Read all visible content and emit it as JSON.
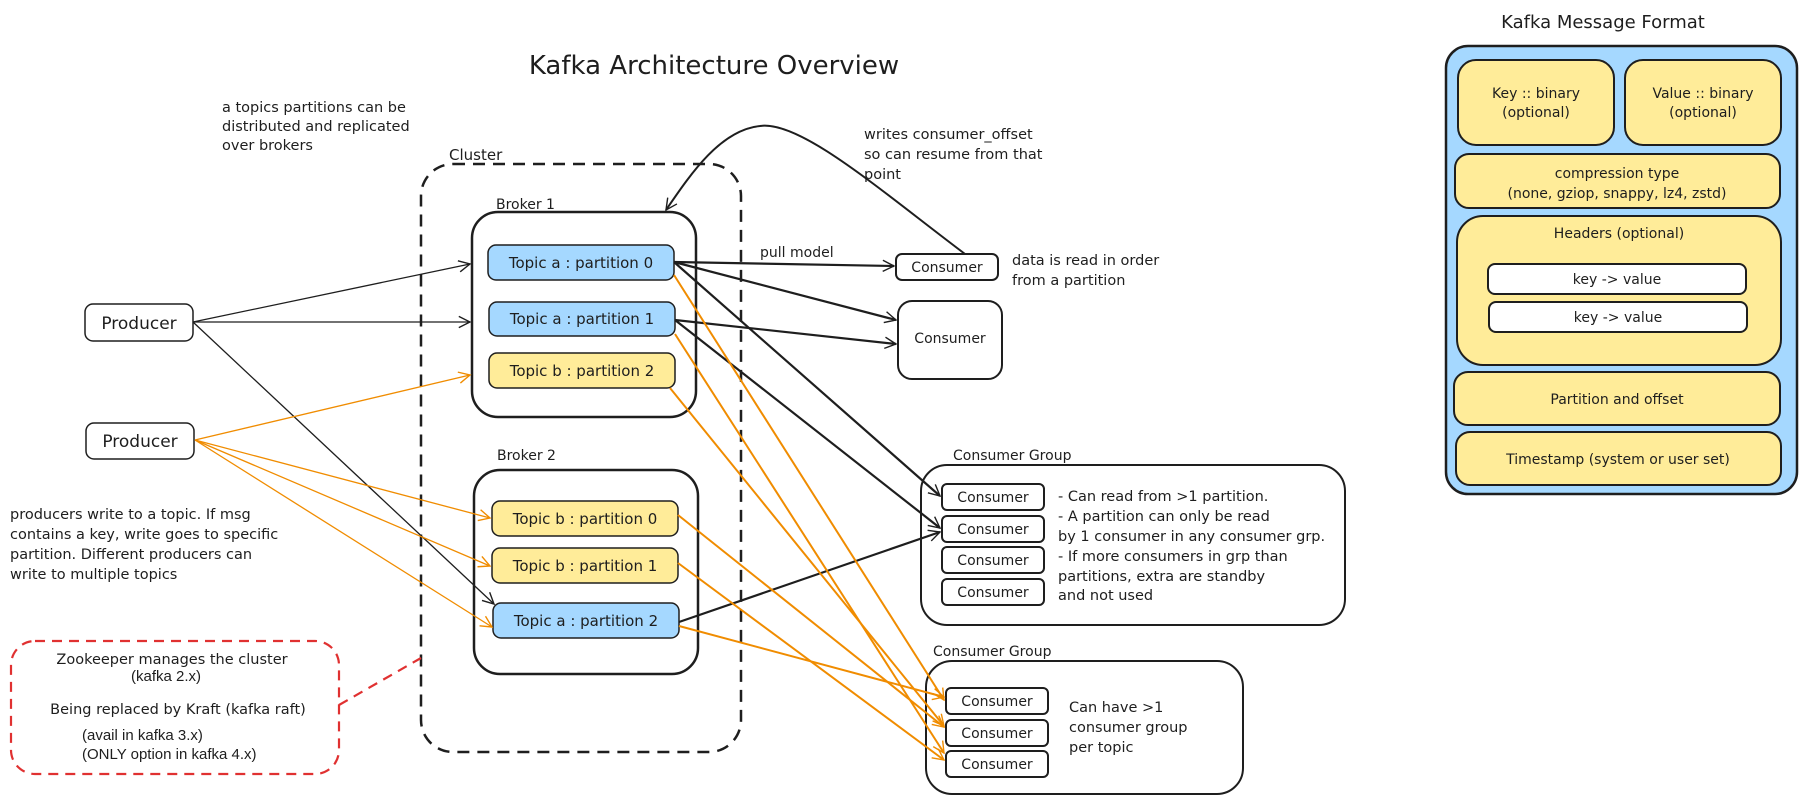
{
  "title": "Kafka Architecture Overview",
  "notes": {
    "partitions_distributed": [
      "a topics partitions can be",
      "distributed and replicated",
      "over brokers"
    ],
    "consumer_offset": [
      "writes consumer_offset",
      "so can resume from that",
      "point"
    ],
    "read_in_order": [
      "data is read in order",
      "from a partition"
    ],
    "producers_write": [
      "producers write to a topic. If msg",
      "contains a key, write goes to specific",
      "partition. Different producers can",
      "write to multiple topics"
    ],
    "pull_model": "pull model"
  },
  "cluster": {
    "label": "Cluster",
    "brokers": [
      {
        "label": "Broker 1",
        "partitions": [
          {
            "label": "Topic a : partition 0",
            "topic": "a"
          },
          {
            "label": "Topic a : partition 1",
            "topic": "a"
          },
          {
            "label": "Topic b : partition 2",
            "topic": "b"
          }
        ]
      },
      {
        "label": "Broker 2",
        "partitions": [
          {
            "label": "Topic b : partition 0",
            "topic": "b"
          },
          {
            "label": "Topic b : partition 1",
            "topic": "b"
          },
          {
            "label": "Topic a : partition 2",
            "topic": "a"
          }
        ]
      }
    ]
  },
  "producers": [
    {
      "label": "Producer",
      "topic": "a"
    },
    {
      "label": "Producer",
      "topic": "b"
    }
  ],
  "standalone_consumers": [
    {
      "label": "Consumer"
    },
    {
      "label": "Consumer"
    }
  ],
  "consumer_groups": [
    {
      "label": "Consumer Group",
      "consumers": [
        "Consumer",
        "Consumer",
        "Consumer",
        "Consumer"
      ],
      "notes": [
        "- Can read from >1 partition.",
        "- A partition can only be read",
        "by 1 consumer in any consumer grp.",
        "- If more consumers in grp than",
        "partitions, extra are standby",
        "and not used"
      ]
    },
    {
      "label": "Consumer Group",
      "consumers": [
        "Consumer",
        "Consumer",
        "Consumer"
      ],
      "notes": [
        "Can have >1",
        "consumer group",
        "per topic"
      ]
    }
  ],
  "zookeeper": {
    "line1": "Zookeeper manages the cluster",
    "line2": "(kafka 2.x)",
    "line3": "Being replaced by Kraft (kafka raft)",
    "line4": "(avail in kafka 3.x)",
    "line5": "(ONLY option in kafka 4.x)"
  },
  "message_format": {
    "title": "Kafka Message Format",
    "key": [
      "Key :: binary",
      "(optional)"
    ],
    "value": [
      "Value :: binary",
      "(optional)"
    ],
    "compression": [
      "compression type",
      "(none, gziop, snappy, lz4, zstd)"
    ],
    "headers": {
      "label": "Headers (optional)",
      "entries": [
        "key -> value",
        "key -> value"
      ]
    },
    "partition_offset": "Partition and offset",
    "timestamp": "Timestamp (system or user set)"
  },
  "colors": {
    "topic_a": "#a5d8ff",
    "topic_b": "#ffec99",
    "topic_b_arrow": "#f08c00",
    "stroke": "#1e1e1e",
    "zookeeper": "#e03131",
    "message_bg": "#a5d8ff",
    "message_field": "#ffec99"
  }
}
